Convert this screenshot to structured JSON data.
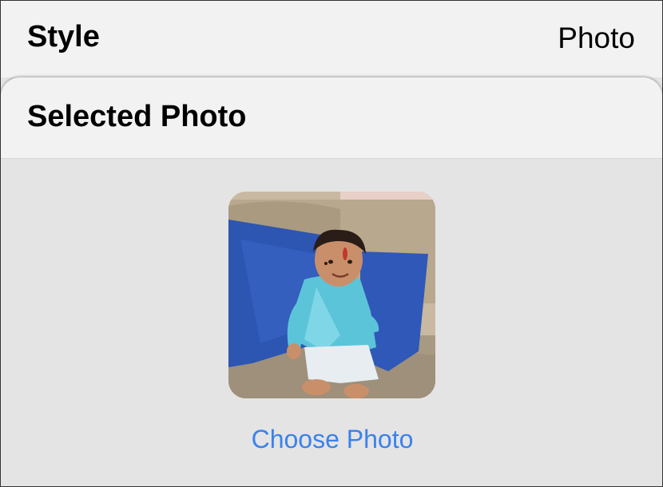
{
  "style_row": {
    "label": "Style",
    "value": "Photo"
  },
  "sheet": {
    "title": "Selected Photo",
    "photo_icon": "photo-thumbnail",
    "choose_label": "Choose Photo"
  },
  "colors": {
    "accent": "#3b82ec",
    "background": "#e4e4e4",
    "header": "#f2f2f2"
  }
}
